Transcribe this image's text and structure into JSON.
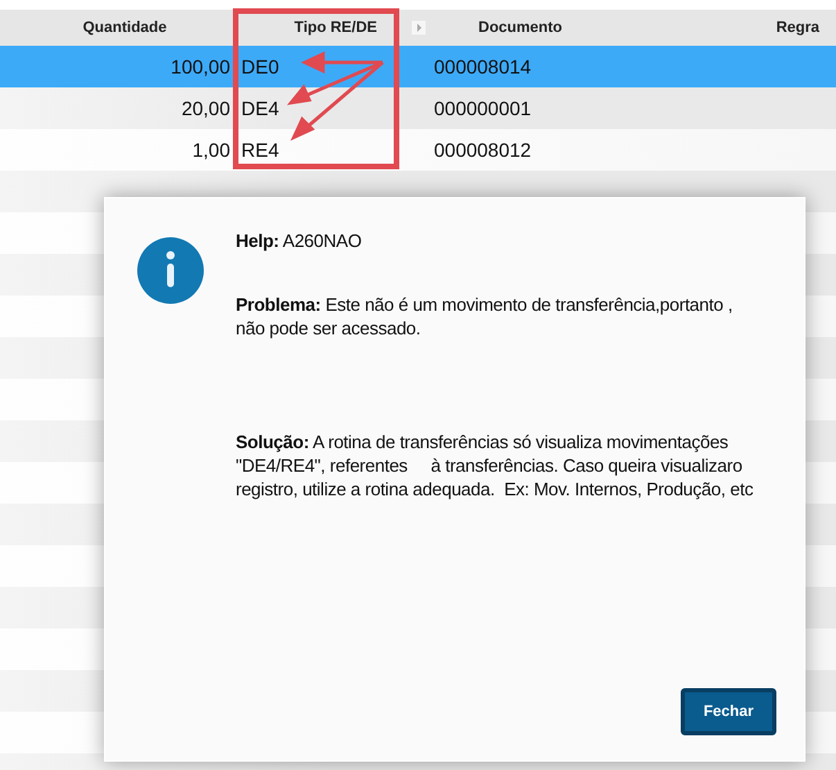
{
  "table": {
    "columns": [
      {
        "label": "Quantidade"
      },
      {
        "label": "Tipo RE/DE"
      },
      {
        "label": "Documento",
        "sort_icon": true
      },
      {
        "label": "Regra"
      }
    ],
    "rows": [
      {
        "quantity": "100,00",
        "type": "DE0",
        "document": "000008014",
        "selected": true
      },
      {
        "quantity": "20,00",
        "type": "DE4",
        "document": "000000001",
        "selected": false
      },
      {
        "quantity": "1,00",
        "type": "RE4",
        "document": "000008012",
        "selected": false
      }
    ]
  },
  "dialog": {
    "help": "**Help:** A260NAO",
    "problem": "**Problema:** Este não é um movimento de transferência,portanto , não pode ser acessado.",
    "solution": "**Solução:** A rotina de transferências só visualiza movimentações \"DE4/RE4\", referentes     à transferências. Caso queira visualizaro registro, utilize a rotina adequada.  Ex: Mov. Internos, Produção, etc",
    "button": "Fechar"
  }
}
